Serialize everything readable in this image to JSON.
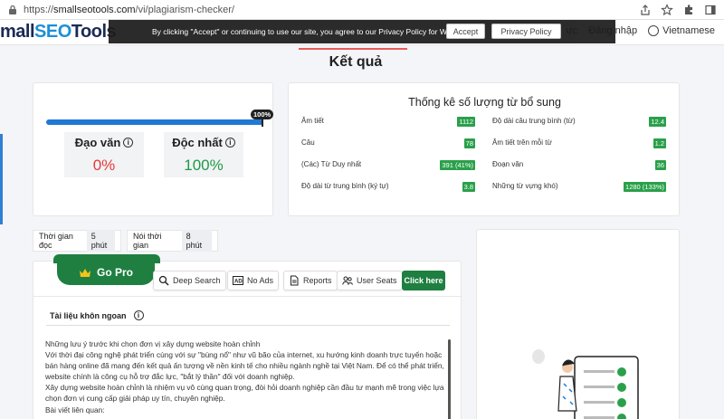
{
  "browser": {
    "url_host": "smallseotools.com",
    "url_path": "/vi/plagiarism-checker/",
    "url_scheme": "https://"
  },
  "site": {
    "logo_prefix": "mall",
    "logo_seo": "SEO",
    "logo_suffix": "Tools",
    "nav_partial": "ực",
    "login": "Đăng nhập",
    "language": "Vietnamese"
  },
  "cookie": {
    "text": "By clicking \"Accept\" or continuing to use our site, you agree to our Privacy Policy for Website",
    "accept": "Accept",
    "privacy": "Privacy Policy"
  },
  "results": {
    "title": "Kết quả",
    "progress_label": "100%",
    "progress_fraction": 1.0,
    "plagiarism_label": "Đạo văn",
    "plagiarism_value": "0%",
    "unique_label": "Độc nhất",
    "unique_value": "100%"
  },
  "stats": {
    "title": "Thống kê số lượng từ bổ sung",
    "left": [
      {
        "label": "Âm tiết",
        "value": "1112"
      },
      {
        "label": "Câu",
        "value": "78"
      },
      {
        "label": "(Các) Từ Duy nhất",
        "value": "391 (41%)"
      },
      {
        "label": "Độ dài từ trung bình (ký tự)",
        "value": "3.8"
      }
    ],
    "right": [
      {
        "label": "Độ dài câu trung bình (từ)",
        "value": "12.4"
      },
      {
        "label": "Âm tiết trên mỗi từ",
        "value": "1.2"
      },
      {
        "label": "Đoạn văn",
        "value": "36"
      },
      {
        "label": "Những từ vựng khó)",
        "value": "1280 (133%)"
      }
    ]
  },
  "times": {
    "read_label": "Thời gian đọc",
    "read_value": "5 phút",
    "speak_label": "Nói thời gian",
    "speak_value": "8 phút"
  },
  "toolbar": {
    "gopro": "Go Pro",
    "deep_search": "Deep Search",
    "no_ads": "No Ads",
    "reports": "Reports",
    "user_seats": "User Seats",
    "click_here": "Click here"
  },
  "document": {
    "title": "Tài liệu khôn ngoan",
    "lines": [
      "Những lưu ý trước khi chọn đơn vị xây dựng website hoàn chỉnh",
      "Với thời đại công nghệ phát triển cùng với sự \"bùng nổ\" như vũ bão của internet, xu hướng kinh doanh trực tuyến hoặc",
      "bán hàng online đã mang đến kết quả ấn tượng về nền kinh tế cho nhiều ngành nghề tại Việt Nam. Để có thể phát triển,",
      "website chính là công cụ hỗ trợ đắc lực, \"bắt lý thần\" đối với doanh nghiệp.",
      "Xây dựng website hoàn chỉnh là nhiệm vụ vô cùng quan trọng, đòi hỏi doanh nghiệp cần đầu tư mạnh mẽ trong việc lựa",
      "chọn đơn vị cung cấp giải pháp uy tín, chuyên nghiệp.",
      "Bài viết liên quan:"
    ]
  },
  "colors": {
    "accent_green": "#1e7f41",
    "badge_green": "#2aa04a",
    "progress_blue": "#2078d4",
    "plag_red": "#e63a3a"
  }
}
